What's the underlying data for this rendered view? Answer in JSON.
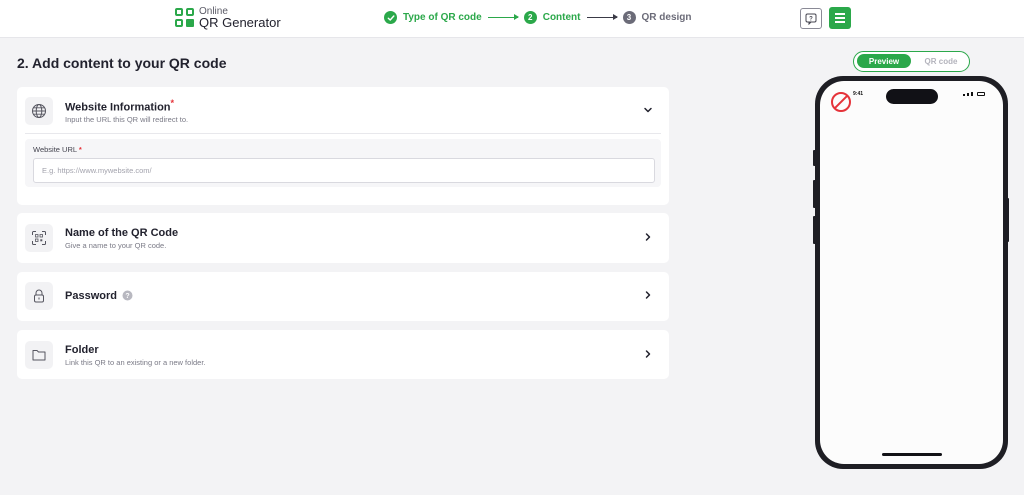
{
  "header": {
    "logo_top": "Online",
    "logo_bottom": "QR Generator",
    "steps": [
      {
        "number": "",
        "label": "Type of QR code",
        "state": "done"
      },
      {
        "number": "2",
        "label": "Content",
        "state": "active"
      },
      {
        "number": "3",
        "label": "QR design",
        "state": "todo"
      }
    ]
  },
  "main": {
    "title": "2. Add content to your QR code",
    "website": {
      "title": "Website Information",
      "required_mark": "*",
      "subtitle": "Input the URL this QR will redirect to.",
      "field_label": "Website URL",
      "field_required_mark": "*",
      "field_value": "",
      "field_placeholder": "E.g. https://www.mywebsite.com/"
    },
    "name_card": {
      "title": "Name of the QR Code",
      "subtitle": "Give a name to your QR code."
    },
    "password_card": {
      "title": "Password"
    },
    "folder_card": {
      "title": "Folder",
      "subtitle": "Link this QR to an existing or a new folder."
    }
  },
  "preview": {
    "toggle_preview": "Preview",
    "toggle_qr": "QR code",
    "status_time": "9:41"
  },
  "colors": {
    "accent": "#2ba84a",
    "required": "#e5333a",
    "no_sign": "#e5333a"
  }
}
